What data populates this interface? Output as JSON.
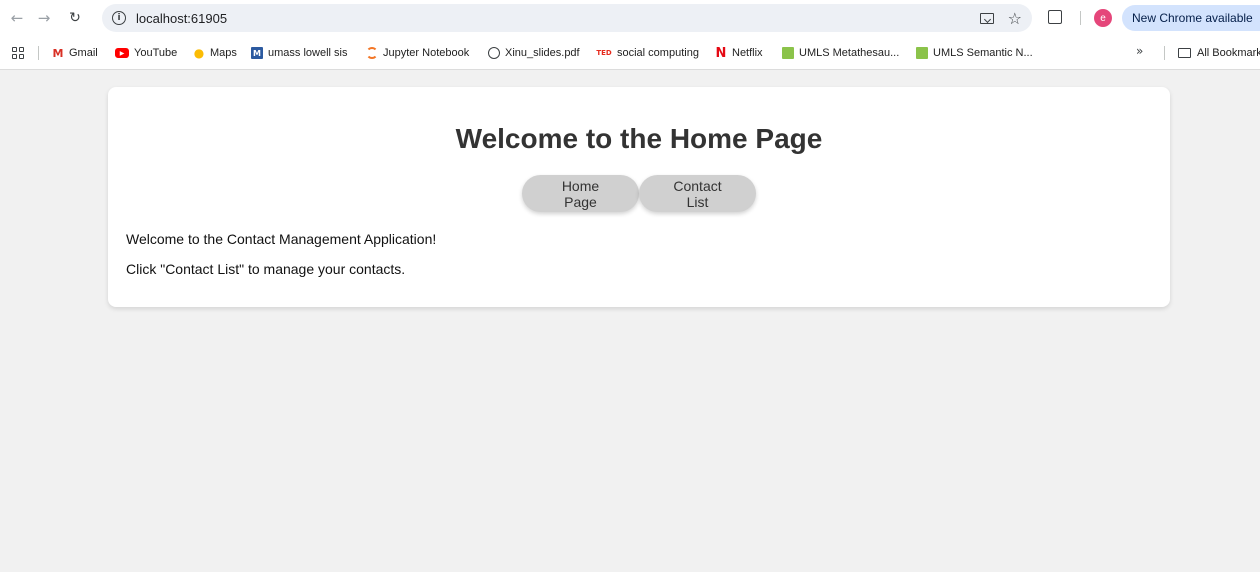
{
  "browser": {
    "url": "localhost:61905",
    "update_chip": "New Chrome available",
    "avatar_letter": "e"
  },
  "bookmarks": [
    {
      "label": "Gmail",
      "icon": "gmail-icon"
    },
    {
      "label": "YouTube",
      "icon": "youtube-icon"
    },
    {
      "label": "Maps",
      "icon": "maps-icon"
    },
    {
      "label": "umass lowell sis",
      "icon": "umass-icon"
    },
    {
      "label": "Jupyter Notebook",
      "icon": "jupyter-icon"
    },
    {
      "label": "Xinu_slides.pdf",
      "icon": "globe-icon"
    },
    {
      "label": "social computing",
      "icon": "ted-icon"
    },
    {
      "label": "Netflix",
      "icon": "netflix-icon"
    },
    {
      "label": "UMLS Metathesau...",
      "icon": "umls-icon"
    },
    {
      "label": "UMLS Semantic N...",
      "icon": "umls-icon"
    }
  ],
  "bookmarks_more": "»",
  "all_bookmarks": "All Bookmarks",
  "page": {
    "title": "Welcome to the Home Page",
    "nav": {
      "home": "Home Page",
      "contacts": "Contact List"
    },
    "welcome": "Welcome to the Contact Management Application!",
    "hint": "Click \"Contact List\" to manage your contacts."
  }
}
